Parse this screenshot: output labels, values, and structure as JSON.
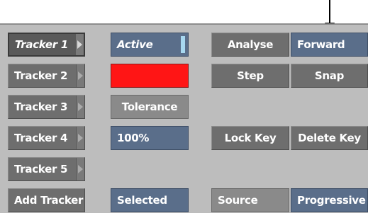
{
  "trackers": [
    {
      "label": "Tracker 1",
      "current": true
    },
    {
      "label": "Tracker 2",
      "current": false
    },
    {
      "label": "Tracker 3",
      "current": false
    },
    {
      "label": "Tracker 4",
      "current": false
    },
    {
      "label": "Tracker 5",
      "current": false
    }
  ],
  "add_tracker_label": "Add Tracker",
  "active_label": "Active",
  "tracker_color": "#ff1515",
  "tolerance_label": "Tolerance",
  "tolerance_value": "100%",
  "selection_mode": "Selected",
  "analyse_label": "Analyse",
  "direction_value": "Forward",
  "step_label": "Step",
  "snap_label": "Snap",
  "lock_key_label": "Lock Key",
  "delete_key_label": "Delete Key",
  "source_label": "Source",
  "source_mode": "Progressive",
  "colors": {
    "panel": "#bdbdbd",
    "button_gray": "#6e6e6e",
    "field_blue": "#5a6e8a",
    "active_indicator": "#a8d8f0"
  }
}
